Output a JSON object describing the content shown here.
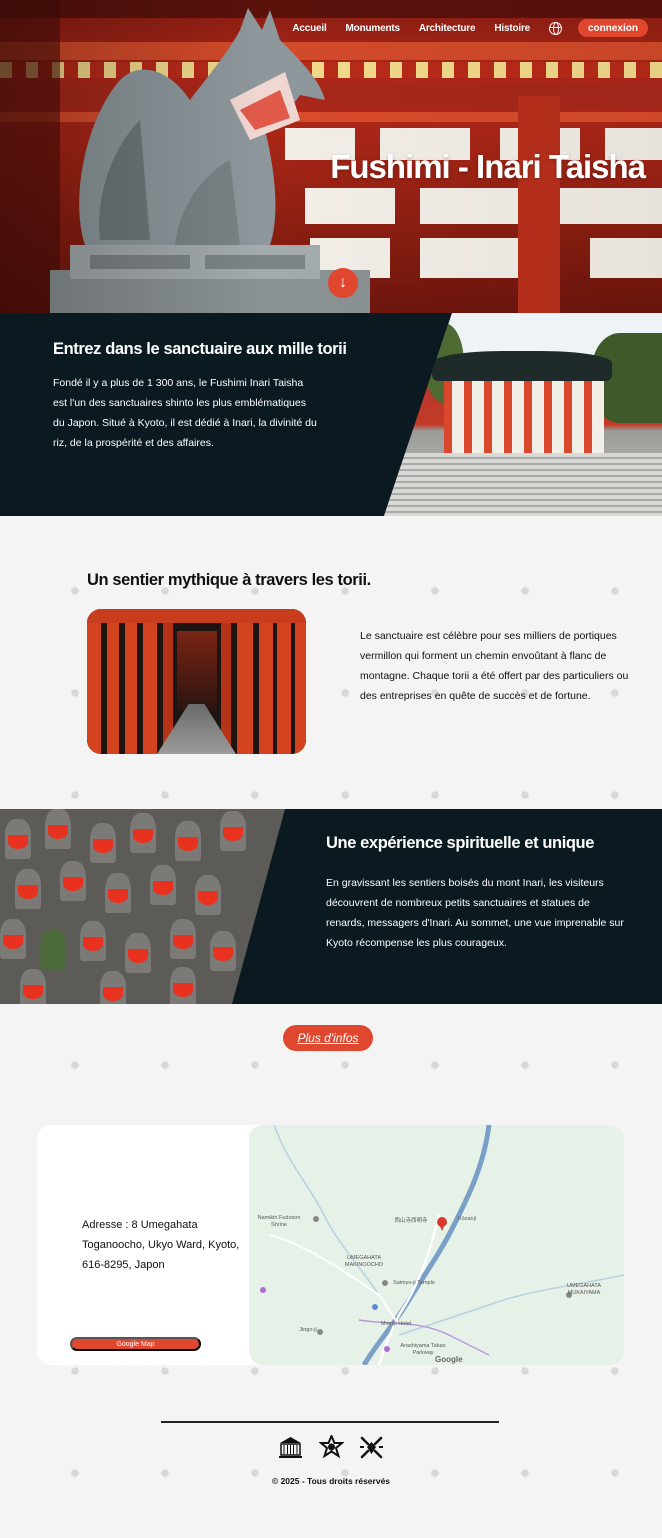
{
  "nav": {
    "items": [
      "Accueil",
      "Monuments",
      "Architecture",
      "Histoire"
    ],
    "login_label": "connexion"
  },
  "hero": {
    "title": "Fushimi - Inari Taisha"
  },
  "section_intro": {
    "title": "Entrez dans le sanctuaire aux mille torii",
    "text": "Fondé il y a plus de 1 300 ans, le Fushimi Inari Taisha est l'un des sanctuaires shinto les plus emblématiques du Japon. Situé à Kyoto, il est dédié à Inari, la divinité du riz, de la prospérité et des affaires."
  },
  "section_torii": {
    "title": "Un sentier mythique à travers les torii.",
    "text": "Le sanctuaire est célèbre pour ses milliers de portiques vermillon qui forment un chemin envoûtant à flanc de montagne. Chaque torii a été offert par des particuliers ou des entreprises en quête de succès et de fortune."
  },
  "section_spiritual": {
    "title": "Une expérience spirituelle et unique",
    "text": "En gravissant les sentiers boisés du mont Inari, les visiteurs découvrent de nombreux petits sanctuaires et statues de renards, messagers d'Inari. Au sommet, une vue imprenable sur Kyoto récompense les plus courageux."
  },
  "more_info_label": "Plus d'infos",
  "location": {
    "address": "Adresse : 8 Umegahata Toganoocho, Ukyo Ward, Kyoto, 616-8295, Japon",
    "map_button": "Google Map",
    "map_labels": {
      "shrine": "Namikiri Fudoson Shrine",
      "kozanji": "Kōzanji",
      "saimyoji": "西山寺西明寺",
      "umegahata_makinoocho": "UMEGAHATA MAKINOOCHO",
      "umegahata_mukaiyama": "UMEGAHATA MUKAIYAMA",
      "saimyo_temple": "Saimyo-ji Temple",
      "park": "Jingo-ji",
      "takao": "Momiji Hotel",
      "parkway": "Arashiyama Takao Parkway",
      "google": "Google"
    }
  },
  "footer": {
    "copyright": "© 2025 - Tous droits réservés"
  },
  "colors": {
    "accent": "#e0472f",
    "dark": "#0b1a21",
    "background": "#f4f4f4"
  },
  "icons": [
    "globe-icon",
    "arrow-down-icon",
    "unesco-icon",
    "japan-emblem-icon",
    "fox-logo-icon",
    "map-pin-icon"
  ]
}
